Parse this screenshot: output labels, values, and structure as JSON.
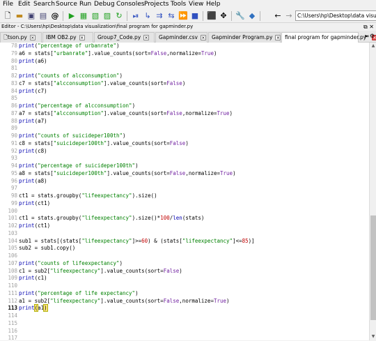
{
  "menu": [
    "File",
    "Edit",
    "Search",
    "Source",
    "Run",
    "Debug",
    "Consoles",
    "Projects",
    "Tools",
    "View",
    "Help"
  ],
  "path_box": "C:\\Users\\hp\\Desktop\\data visualizatio",
  "editor_title": "Editor - C:\\Users\\hp\\Desktop\\data visualization\\final program for gapminder.py",
  "tabs": [
    {
      "label": "tson.py"
    },
    {
      "label": "IBM OB2.py"
    },
    {
      "label": "Group7_Code.py"
    },
    {
      "label": "Gapminder.csv"
    },
    {
      "label": "Gapminder Program.py"
    },
    {
      "label": "final program for gapminder.py*"
    }
  ],
  "active_tab": 5,
  "current_line": "113",
  "code": [
    {
      "n": "78",
      "t": "print(\"percentage of urbanrate\")"
    },
    {
      "n": "79",
      "t": "a6 = stats[\"urbanrate\"].value_counts(sort=False,normalize=True)"
    },
    {
      "n": "80",
      "t": "print(a6)"
    },
    {
      "n": "81",
      "t": ""
    },
    {
      "n": "82",
      "t": "print(\"counts of alcconsumption\")"
    },
    {
      "n": "83",
      "t": "c7 = stats[\"alcconsumption\"].value_counts(sort=False)"
    },
    {
      "n": "84",
      "t": "print(c7)"
    },
    {
      "n": "85",
      "t": ""
    },
    {
      "n": "86",
      "t": "print(\"percentage of alcconsumption\")"
    },
    {
      "n": "87",
      "t": "a7 = stats[\"alcconsumption\"].value_counts(sort=False,normalize=True)"
    },
    {
      "n": "88",
      "t": "print(a7)"
    },
    {
      "n": "89",
      "t": ""
    },
    {
      "n": "90",
      "t": "print(\"counts of suicideper100th\")"
    },
    {
      "n": "91",
      "t": "c8 = stats[\"suicideper100th\"].value_counts(sort=False)"
    },
    {
      "n": "92",
      "t": "print(c8)"
    },
    {
      "n": "93",
      "t": ""
    },
    {
      "n": "94",
      "t": "print(\"percentage of suicideper100th\")"
    },
    {
      "n": "95",
      "t": "a8 = stats[\"suicideper100th\"].value_counts(sort=False,normalize=True)"
    },
    {
      "n": "96",
      "t": "print(a8)"
    },
    {
      "n": "97",
      "t": ""
    },
    {
      "n": "98",
      "t": "ct1 = stats.groupby(\"lifeexpectancy\").size()"
    },
    {
      "n": "99",
      "t": "print(ct1)"
    },
    {
      "n": "100",
      "t": ""
    },
    {
      "n": "101",
      "t": "ct1 = stats.groupby(\"lifeexpectancy\").size()*100/len(stats)"
    },
    {
      "n": "102",
      "t": "print(ct1)"
    },
    {
      "n": "103",
      "t": ""
    },
    {
      "n": "104",
      "t": "sub1 = stats[(stats[\"lifeexpectancy\"]>=60) & (stats[\"lifeexpectancy\"]<=85)]"
    },
    {
      "n": "105",
      "t": "sub2 = sub1.copy()"
    },
    {
      "n": "106",
      "t": ""
    },
    {
      "n": "107",
      "t": "print(\"counts of lifeexpectancy\")"
    },
    {
      "n": "108",
      "t": "c1 = sub2[\"lifeexpectancy\"].value_counts(sort=False)"
    },
    {
      "n": "109",
      "t": "print(c1)"
    },
    {
      "n": "110",
      "t": ""
    },
    {
      "n": "111",
      "t": "print(\"percentage of life expectancy\")"
    },
    {
      "n": "112",
      "t": "a1 = sub2[\"lifeexpectancy\"].value_counts(sort=False,normalize=True)"
    },
    {
      "n": "113",
      "t": "print(a1)"
    },
    {
      "n": "114",
      "t": ""
    },
    {
      "n": "115",
      "t": ""
    },
    {
      "n": "116",
      "t": ""
    },
    {
      "n": "117",
      "t": ""
    }
  ]
}
